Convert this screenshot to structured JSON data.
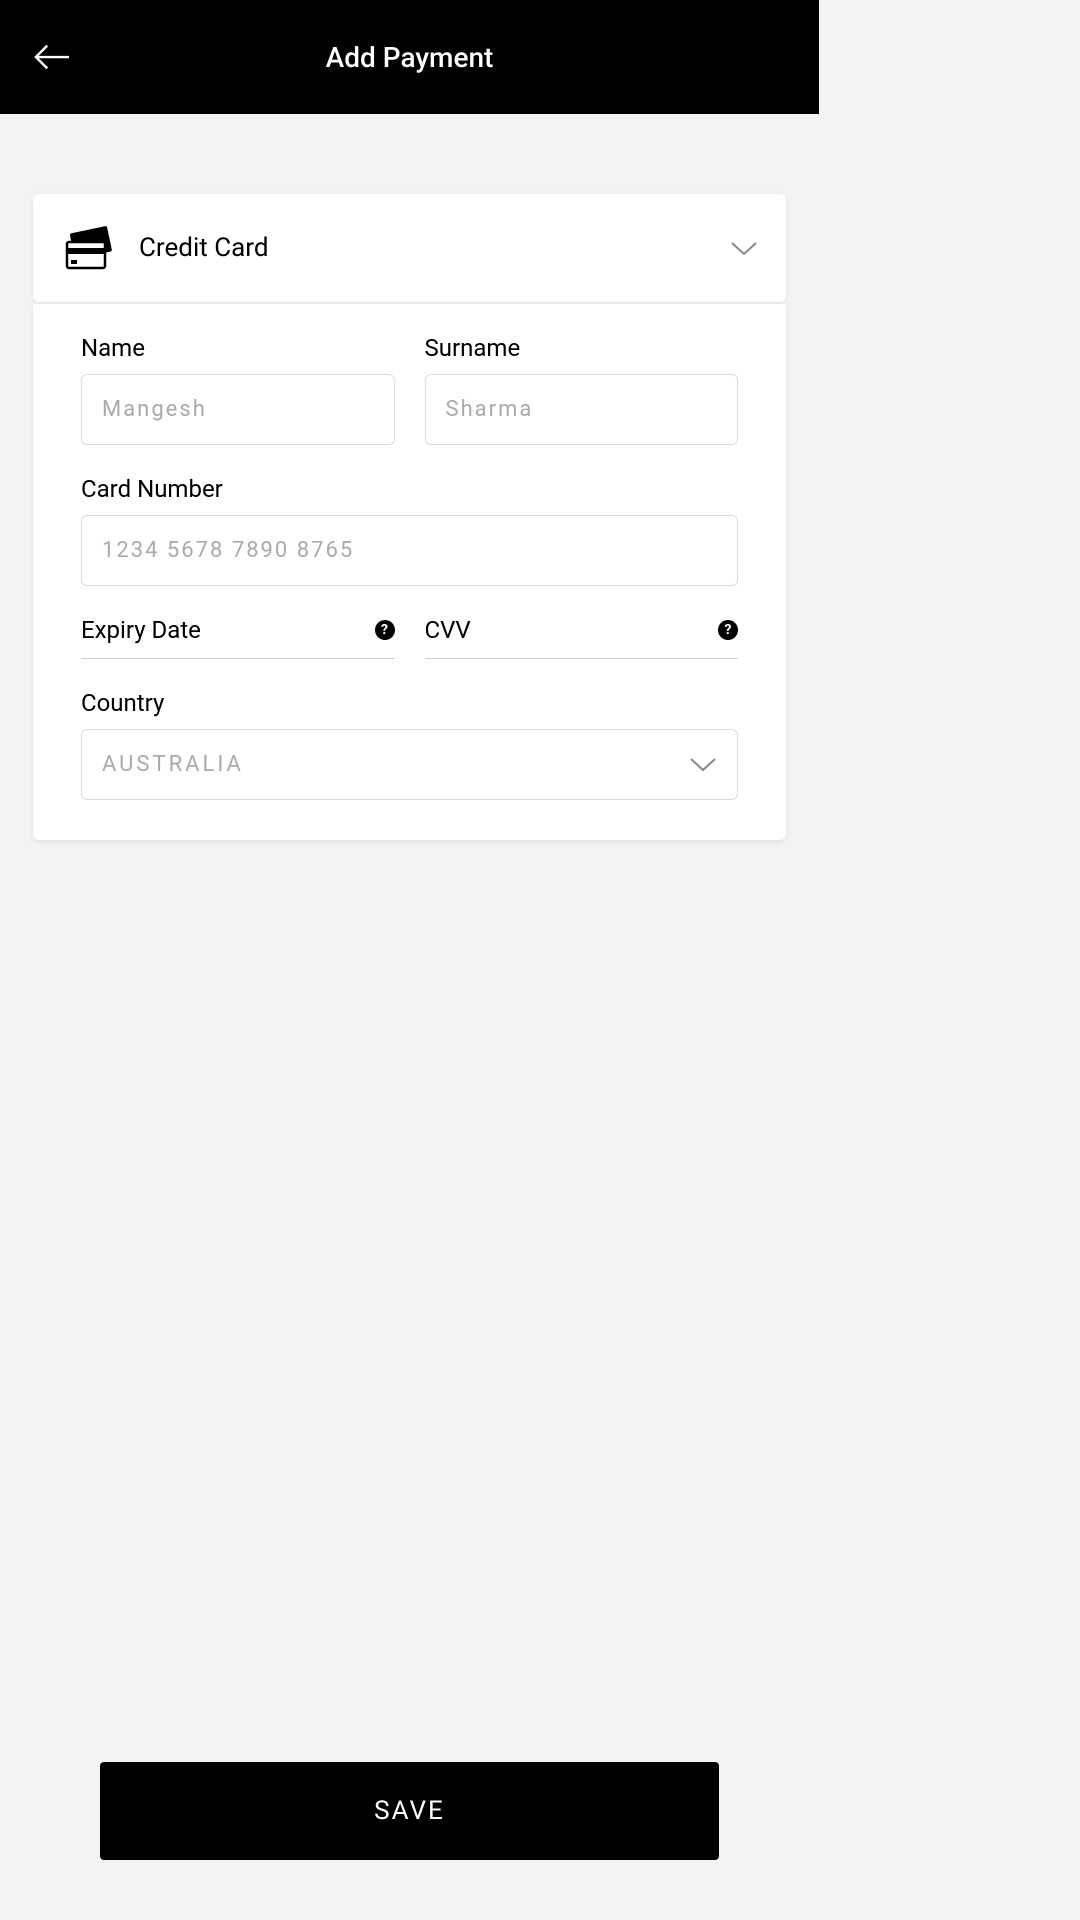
{
  "header": {
    "title": "Add Payment"
  },
  "paymentMethod": {
    "label": "Credit Card"
  },
  "fields": {
    "name": {
      "label": "Name",
      "placeholder": "Mangesh"
    },
    "surname": {
      "label": "Surname",
      "placeholder": "Sharma"
    },
    "cardNumber": {
      "label": "Card Number",
      "placeholder": "1234 5678 7890 8765"
    },
    "expiry": {
      "label": "Expiry Date"
    },
    "cvv": {
      "label": "CVV"
    },
    "country": {
      "label": "Country",
      "value": "AUSTRALIA"
    }
  },
  "buttons": {
    "save": "SAVE"
  }
}
